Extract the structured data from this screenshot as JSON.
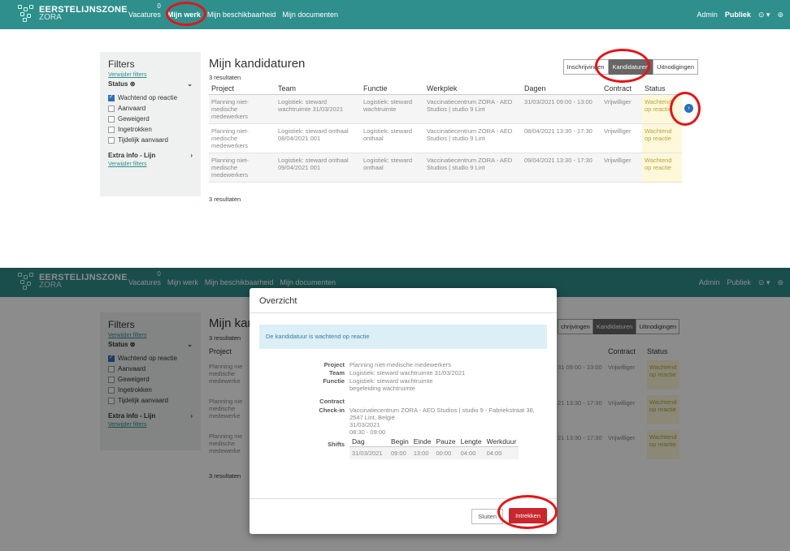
{
  "app": {
    "brand_line1": "EERSTELIJNSZONE",
    "brand_line2": "ZORA"
  },
  "nav": {
    "items": [
      "Vacatures",
      "Mijn werk",
      "Mijn beschikbaarheid",
      "Mijn documenten"
    ],
    "vacatures_badge": "0",
    "right": [
      "Admin",
      "Publiek",
      "⊙ ▾",
      "⊚"
    ]
  },
  "filters": {
    "title": "Filters",
    "clear_link": "Verwijder filters",
    "status_label": "Status",
    "status_icon": "⊗",
    "options": [
      "Wachtend op reactie",
      "Aanvaard",
      "Geweigerd",
      "Ingetrokken",
      "Tijdelijk aanvaard"
    ],
    "extra_label": "Extra info - Lijn",
    "clear_link2": "Verwijder filters"
  },
  "main": {
    "title": "Mijn kandidaturen",
    "count_top": "3 resultaten",
    "count_bottom": "3 resultaten",
    "tabs": [
      "Inschrijvingen",
      "Kandidaturen",
      "Uitnodigingen"
    ],
    "columns": [
      "Project",
      "Team",
      "Functie",
      "Werkplek",
      "Dagen",
      "Contract",
      "Status"
    ],
    "rows": [
      [
        "Planning niet-medische medewerkers",
        "Logistiek: steward wachtruimte 31/03/2021",
        "Logistiek: steward wachtruimte",
        "Vaccinatiecentrum ZORA - AED Studios | studio 9 Lint",
        "31/03/2021 09:00 - 13:00",
        "Vrijwilliger",
        "Wachtend op reactie"
      ],
      [
        "Planning niet-medische medewerkers",
        "Logistiek: steward onthaal 08/04/2021 001",
        "Logistiek: steward onthaal",
        "Vaccinatiecentrum ZORA - AED Studios | studio 9 Lint",
        "08/04/2021 13:30 - 17:30",
        "Vrijwilliger",
        "Wachtend op reactie"
      ],
      [
        "Planning niet-medische medewerkers",
        "Logistiek: steward onthaal 09/04/2021 001",
        "Logistiek: steward onthaal",
        "Vaccinatiecentrum ZORA - AED Studios | studio 9 Lint",
        "09/04/2021 13:30 - 17:30",
        "Vrijwilliger",
        "Wachtend op reactie"
      ]
    ],
    "behind_dates": [
      "31 09:00 - 13:00",
      "21 13:30 - 17:30",
      "21 13:30 - 17:30"
    ],
    "behind_tabs": [
      "chrijvingen"
    ],
    "behind_title": "Mijn kan",
    "behind_project": [
      "Planning nie",
      "medische",
      "medewerke"
    ]
  },
  "modal": {
    "title": "Overzicht",
    "alert": "De kandidatuur is wachtend op reactie",
    "labels": {
      "project": "Project",
      "team": "Team",
      "function": "Functie",
      "contract": "Contract",
      "checkin": "Check-in",
      "shifts": "Shifts"
    },
    "project": "Planning niet-medische medewerkers",
    "team": "Logistiek: steward wachtruimte 31/03/2021",
    "function_line1": "Logistiek: steward wachtruimte",
    "function_line2": "begeleiding wachtruimte",
    "checkin_line1": "Vaccinatiecentrum ZORA - AED Studios | studio 9 - Fabriekstraat 38,",
    "checkin_line2": "2547 Lint, België",
    "checkin_line3": "31/03/2021",
    "checkin_line4": "08:30 - 09:00",
    "shift_columns": [
      "Dag",
      "Begin",
      "Einde",
      "Pauze",
      "Lengte",
      "Werkduur"
    ],
    "shift_row": [
      "31/03/2021",
      "09:00",
      "13:00",
      "00:00",
      "04:00",
      "04:00"
    ],
    "close_label": "Sluiten",
    "withdraw_label": "Intrekken"
  },
  "colors": {
    "nav": "#2e8f8c",
    "highlight_ring": "#e0161a",
    "withdraw": "#c8272d",
    "status_bg": "#fdf8d9"
  }
}
